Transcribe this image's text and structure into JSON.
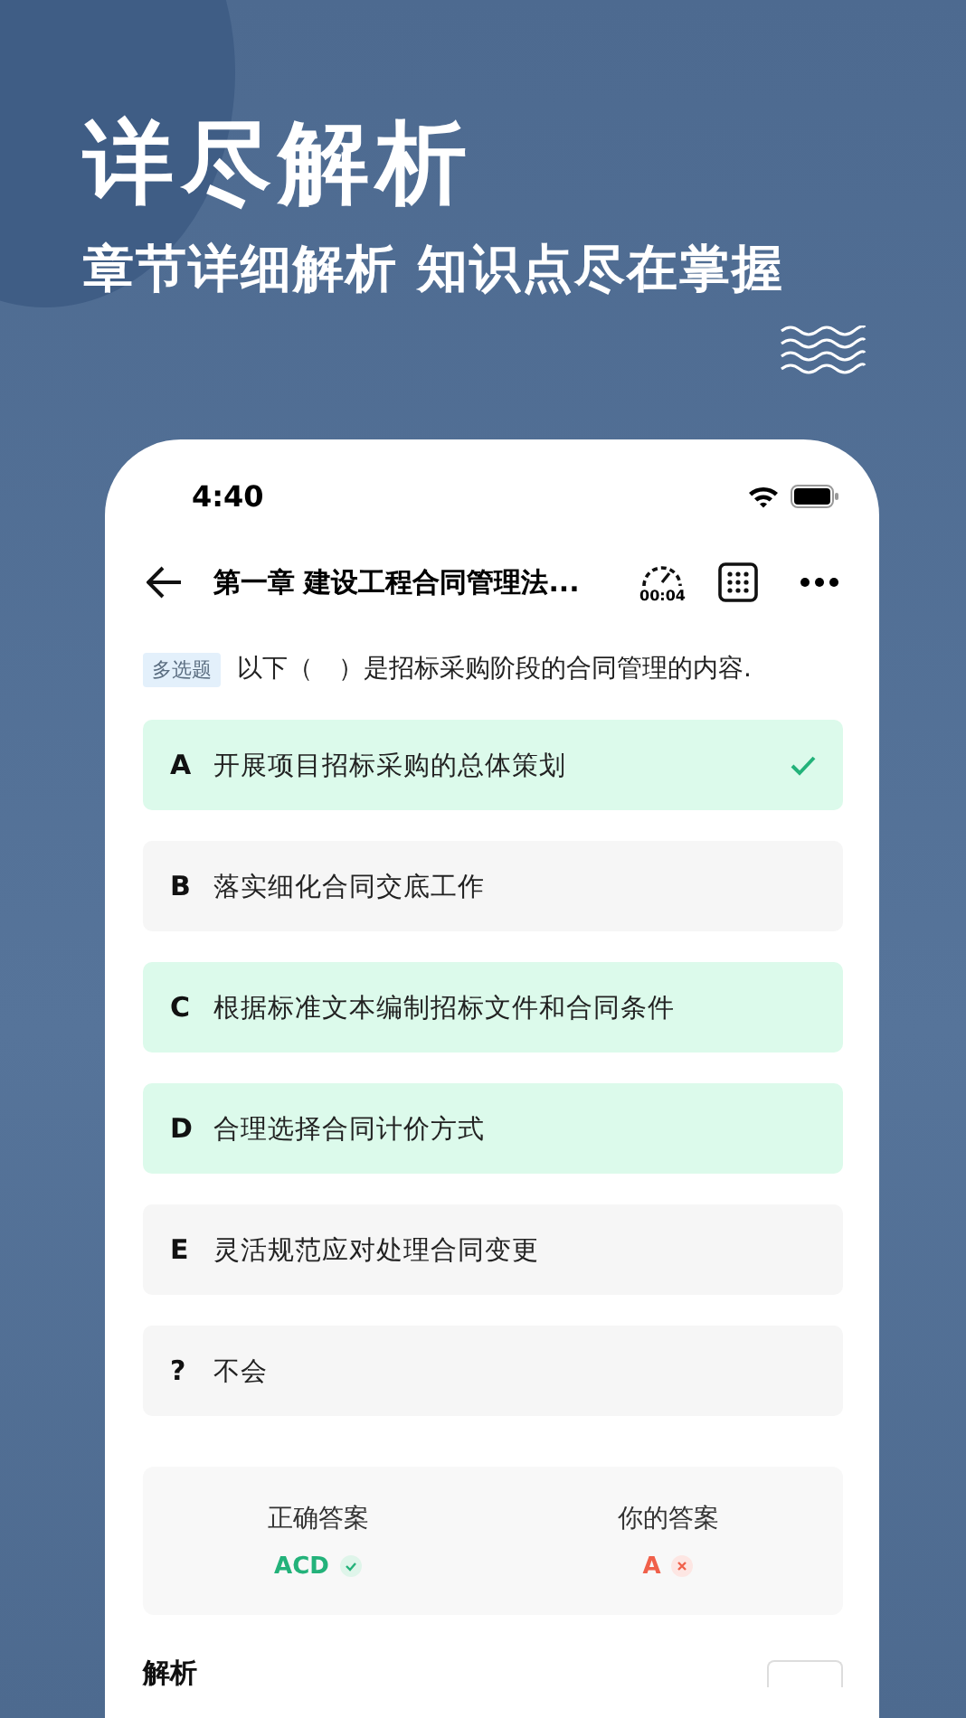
{
  "headline": "详尽解析",
  "subtitle": "章节详细解析 知识点尽在掌握",
  "status_bar": {
    "time": "4:40"
  },
  "nav": {
    "title": "第一章 建设工程合同管理法...",
    "timer": "00:04"
  },
  "question": {
    "type_tag": "多选题",
    "text": "以下（　）是招标采购阶段的合同管理的内容."
  },
  "options": [
    {
      "letter": "A",
      "text": "开展项目招标采购的总体策划",
      "correct": true,
      "selected": true
    },
    {
      "letter": "B",
      "text": "落实细化合同交底工作",
      "correct": false,
      "selected": false
    },
    {
      "letter": "C",
      "text": "根据标准文本编制招标文件和合同条件",
      "correct": true,
      "selected": false
    },
    {
      "letter": "D",
      "text": "合理选择合同计价方式",
      "correct": true,
      "selected": false
    },
    {
      "letter": "E",
      "text": "灵活规范应对处理合同变更",
      "correct": false,
      "selected": false
    },
    {
      "letter": "?",
      "text": "不会",
      "correct": false,
      "selected": false
    }
  ],
  "answers": {
    "correct_label": "正确答案",
    "correct_value": "ACD",
    "yours_label": "你的答案",
    "yours_value": "A",
    "yours_correct": false
  },
  "analysis": {
    "title": "解析"
  }
}
